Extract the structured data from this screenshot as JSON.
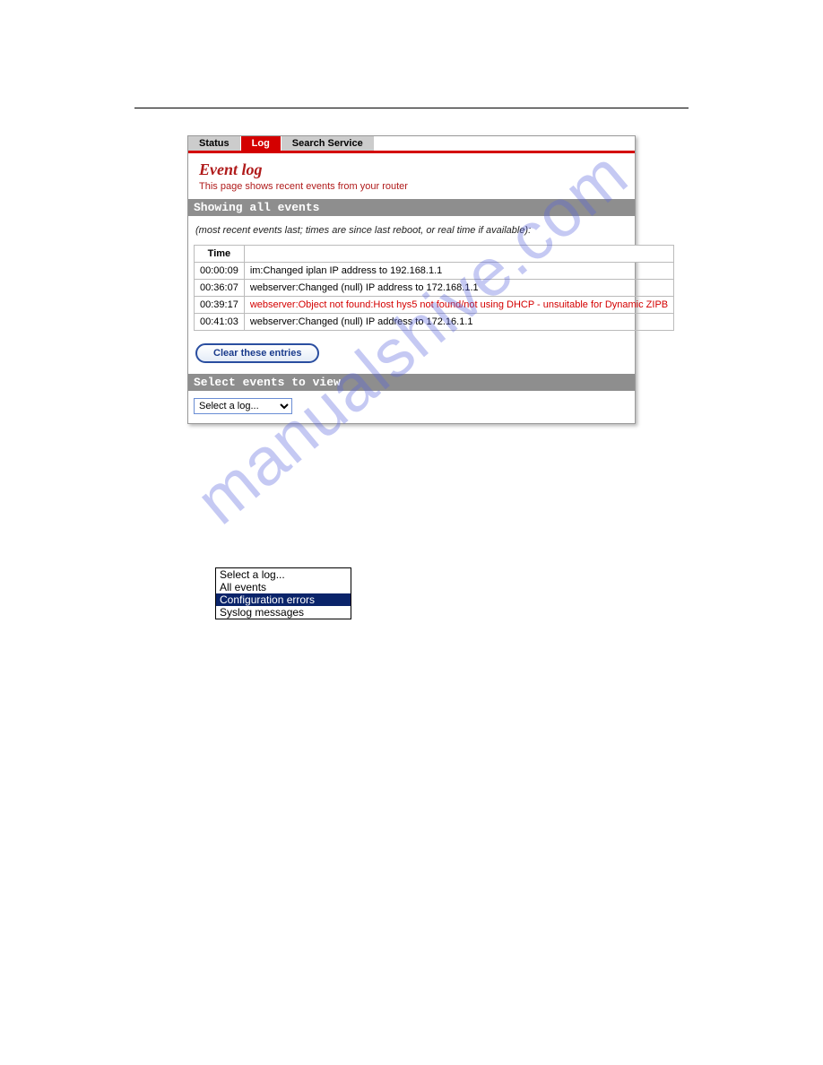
{
  "watermark": "manualshive.com",
  "tabs": {
    "status": "Status",
    "log": "Log",
    "search": "Search Service"
  },
  "page_title": "Event log",
  "page_sub": "This page shows recent events from your router",
  "section_all": "Showing all events",
  "hint": "(most recent events last; times are since last reboot, or real time if available):",
  "table": {
    "col_time": "Time",
    "rows": [
      {
        "time": "00:00:09",
        "msg": "im:Changed iplan IP address to 192.168.1.1",
        "err": false
      },
      {
        "time": "00:36:07",
        "msg": "webserver:Changed (null) IP address to 172.168.1.1",
        "err": false
      },
      {
        "time": "00:39:17",
        "msg": "webserver:Object not found:Host hys5 not found/not using DHCP - unsuitable for Dynamic ZIPB",
        "err": true
      },
      {
        "time": "00:41:03",
        "msg": "webserver:Changed (null) IP address to 172.16.1.1",
        "err": false
      }
    ]
  },
  "clear_btn": "Clear these entries",
  "section_select": "Select events to view",
  "select_default": "Select a log...",
  "dd_options": {
    "o0": "Select a log...",
    "o1": "All events",
    "o2": "Configuration errors",
    "o3": "Syslog messages"
  }
}
